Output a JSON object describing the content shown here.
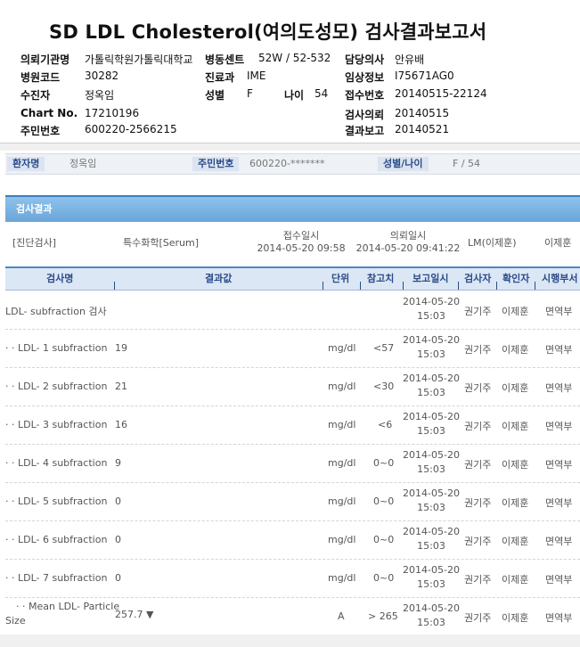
{
  "report": {
    "title": "SD LDL Cholesterol(여의도성모) 검사결과보고서",
    "fields": {
      "institution_label": "의뢰기관명",
      "institution_value": "가톨릭학원가톨릭대학교",
      "ward_label": "병동센트",
      "ward_value": "52W / 52-532",
      "doctor_label": "담당의사",
      "doctor_value": "안유배",
      "hospcode_label": "병원코드",
      "hospcode_value": "30282",
      "dept_label": "진료과",
      "dept_value": "IME",
      "clinical_label": "임상정보",
      "clinical_value": "I75671AG0",
      "recipient_label": "수진자",
      "recipient_value": "정옥임",
      "sex_label": "성별",
      "sex_value": "F",
      "age_label": "나이",
      "age_value": "54",
      "receipt_label": "접수번호",
      "receipt_value": "20140515-22124",
      "chart_label": "Chart No.",
      "chart_value": "17210196",
      "request_label": "검사의뢰",
      "request_value": "20140515",
      "rrn_label": "주민번호",
      "rrn_value": "600220-2566215",
      "result_label": "결과보고",
      "result_value": "20140521"
    }
  },
  "patient_bar": {
    "name_label": "환자명",
    "name_value": "정옥임",
    "rrn_label": "주민번호",
    "rrn_value": "600220-*******",
    "sexage_label": "성별/나이",
    "sexage_value": "F / 54"
  },
  "section": {
    "title": "검사결과"
  },
  "info": {
    "diag": "[진단검사]",
    "specimen": "특수화학[Serum]",
    "recv_label": "접수일시",
    "recv_value": "2014-05-20 09:58",
    "req_label": "의뢰일시",
    "req_value": "2014-05-20 09:41:22",
    "lm": "LM(이제훈)",
    "lm_name": "이제훈"
  },
  "table": {
    "headers": {
      "name": "검사명",
      "result": "결과값",
      "unit": "단위",
      "ref": "참고치",
      "reported": "보고일시",
      "tester": "검사자",
      "confirmer": "확인자",
      "dept": "시행부서"
    },
    "rows": [
      {
        "name": "LDL- subfraction 검사",
        "result": "",
        "unit": "",
        "ref": "",
        "date": "2014-05-20",
        "time": "15:03",
        "tester": "권기주",
        "confirmer": "이제훈",
        "dept": "면역부"
      },
      {
        "name": "· · LDL- 1 subfraction",
        "result": "19",
        "unit": "mg/dl",
        "ref": "<57",
        "date": "2014-05-20",
        "time": "15:03",
        "tester": "권기주",
        "confirmer": "이제훈",
        "dept": "면역부"
      },
      {
        "name": "· · LDL- 2 subfraction",
        "result": "21",
        "unit": "mg/dl",
        "ref": "<30",
        "date": "2014-05-20",
        "time": "15:03",
        "tester": "권기주",
        "confirmer": "이제훈",
        "dept": "면역부"
      },
      {
        "name": "· · LDL- 3 subfraction",
        "result": "16",
        "unit": "mg/dl",
        "ref": "<6",
        "date": "2014-05-20",
        "time": "15:03",
        "tester": "권기주",
        "confirmer": "이제훈",
        "dept": "면역부"
      },
      {
        "name": "· · LDL- 4 subfraction",
        "result": "9",
        "unit": "mg/dl",
        "ref": "0~0",
        "date": "2014-05-20",
        "time": "15:03",
        "tester": "권기주",
        "confirmer": "이제훈",
        "dept": "면역부"
      },
      {
        "name": "· · LDL- 5 subfraction",
        "result": "0",
        "unit": "mg/dl",
        "ref": "0~0",
        "date": "2014-05-20",
        "time": "15:03",
        "tester": "권기주",
        "confirmer": "이제훈",
        "dept": "면역부"
      },
      {
        "name": "· · LDL- 6 subfraction",
        "result": "0",
        "unit": "mg/dl",
        "ref": "0~0",
        "date": "2014-05-20",
        "time": "15:03",
        "tester": "권기주",
        "confirmer": "이제훈",
        "dept": "면역부"
      },
      {
        "name": "· · LDL- 7 subfraction",
        "result": "0",
        "unit": "mg/dl",
        "ref": "0~0",
        "date": "2014-05-20",
        "time": "15:03",
        "tester": "권기주",
        "confirmer": "이제훈",
        "dept": "면역부"
      },
      {
        "name": "· · Mean LDL- Particle",
        "name2": "Size",
        "result": "257.7 ▼",
        "unit": "A",
        "ref": "> 265",
        "date": "2014-05-20",
        "time": "15:03",
        "tester": "권기주",
        "confirmer": "이제훈",
        "dept": "면역부"
      }
    ]
  }
}
